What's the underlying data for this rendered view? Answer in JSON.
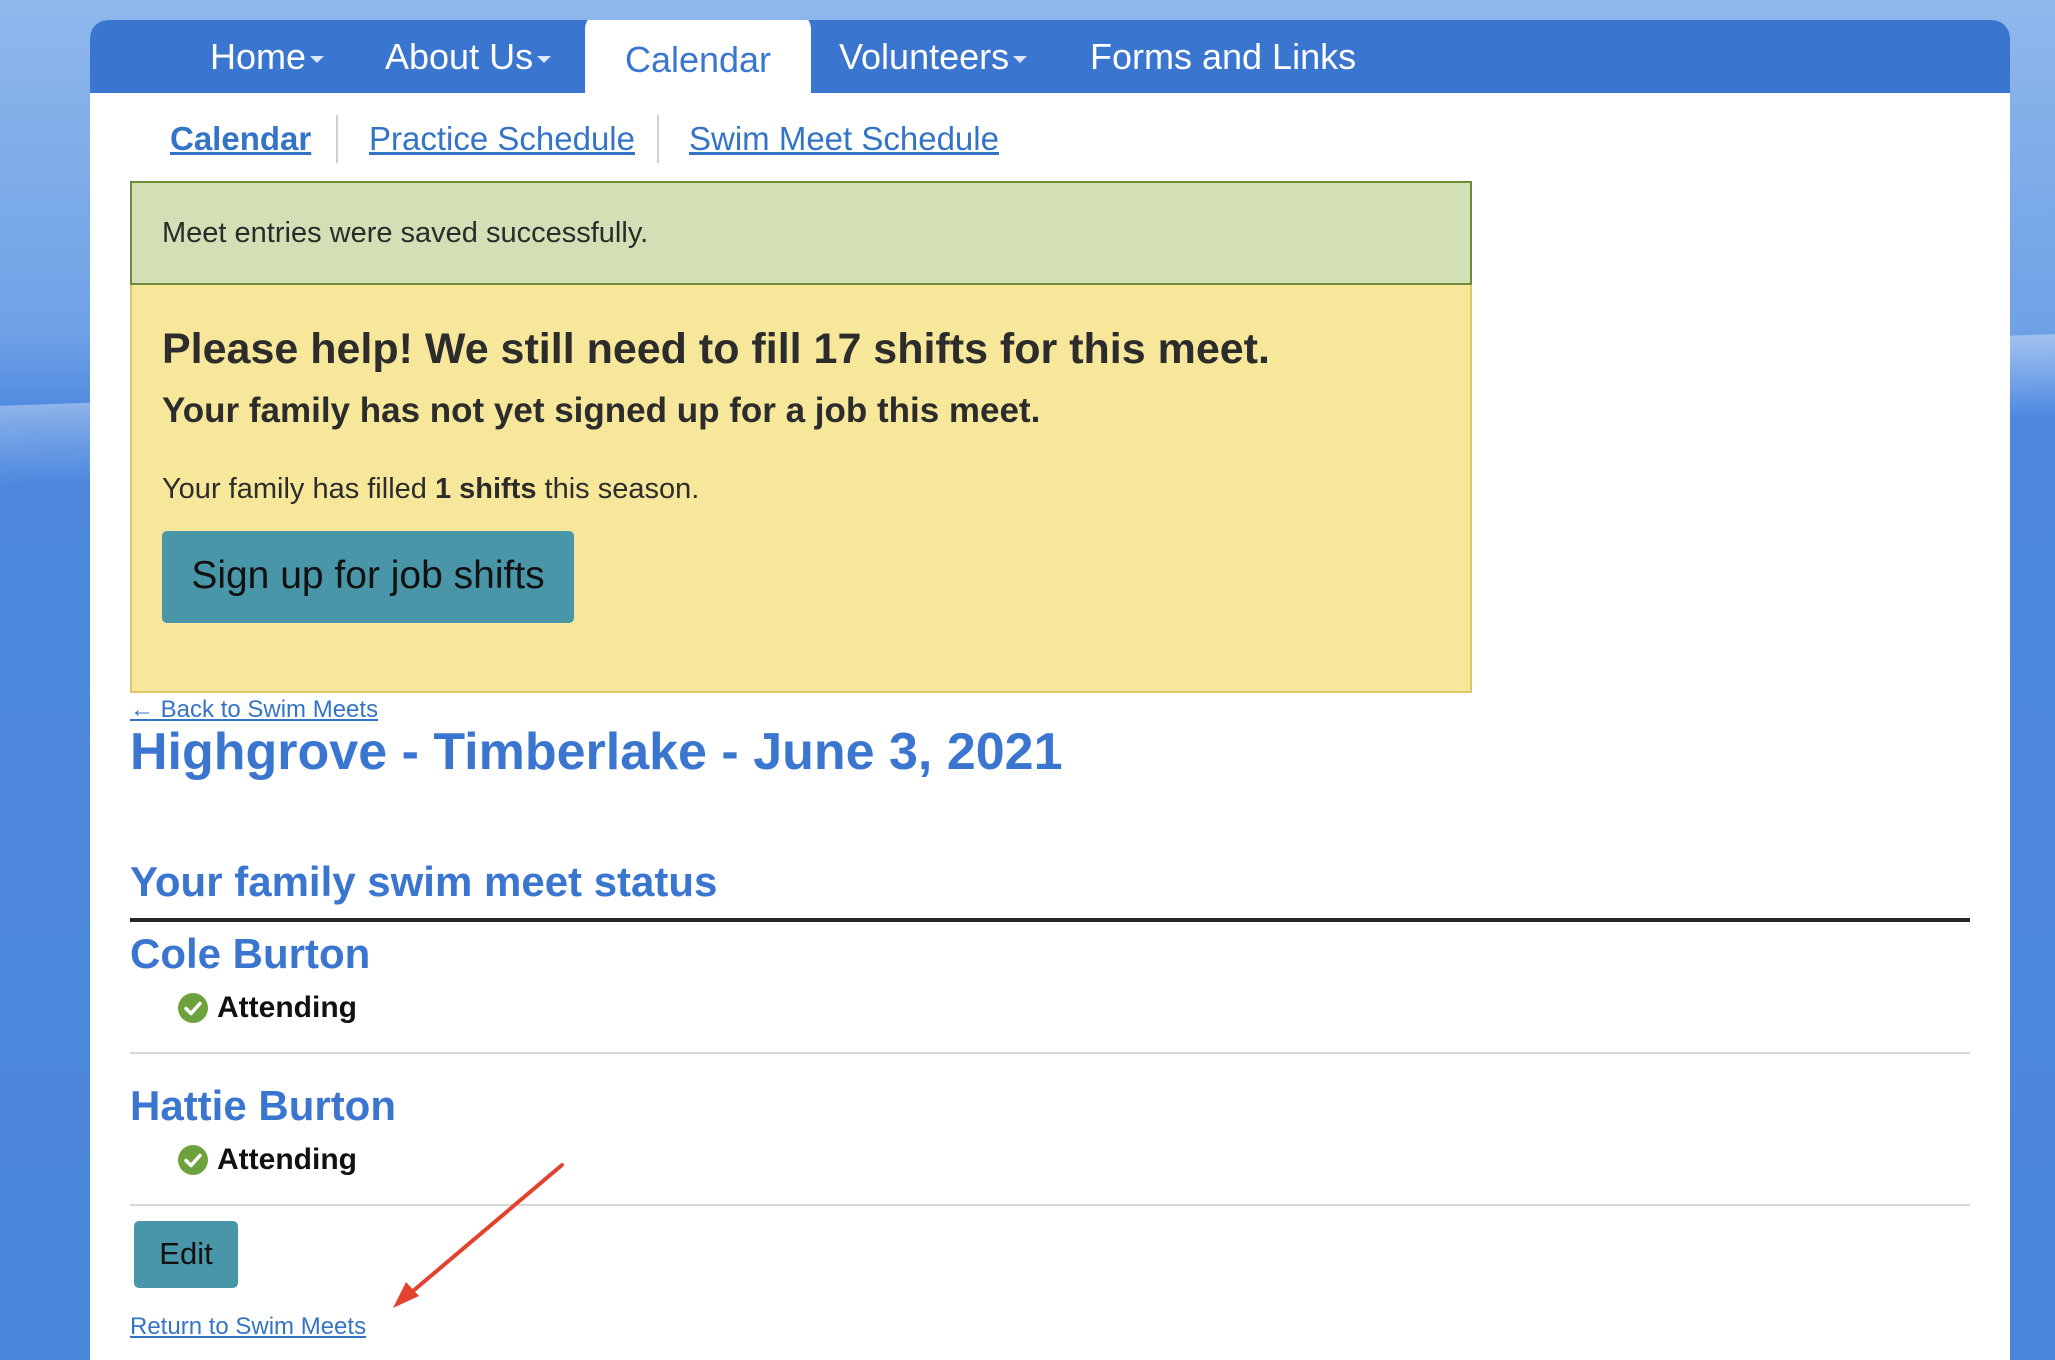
{
  "nav": {
    "items": [
      {
        "label": "Home",
        "dropdown": true
      },
      {
        "label": "About Us",
        "dropdown": true
      },
      {
        "label": "Calendar",
        "dropdown": false,
        "active": true
      },
      {
        "label": "Volunteers",
        "dropdown": true
      },
      {
        "label": "Forms and Links",
        "dropdown": false
      }
    ]
  },
  "subnav": {
    "items": [
      {
        "label": "Calendar",
        "active": true
      },
      {
        "label": "Practice Schedule",
        "active": false
      },
      {
        "label": "Swim Meet Schedule",
        "active": false
      }
    ]
  },
  "alerts": {
    "success": "Meet entries were saved successfully.",
    "warning": {
      "title": "Please help! We still need to fill 17 shifts for this meet.",
      "subtitle": "Your family has not yet signed up for a job this meet.",
      "filled_prefix": "Your family has filled ",
      "filled_count": "1 shifts",
      "filled_suffix": " this season.",
      "button_label": "Sign up for job shifts"
    }
  },
  "meet": {
    "back_link": "← Back to Swim Meets",
    "title": "Highgrove - Timberlake - June 3, 2021",
    "status_heading": "Your family swim meet status",
    "swimmers": [
      {
        "name": "Cole Burton",
        "status": "Attending"
      },
      {
        "name": "Hattie Burton",
        "status": "Attending"
      }
    ],
    "edit_label": "Edit",
    "return_link": "Return to Swim Meets"
  },
  "colors": {
    "nav_blue": "#3a75cf",
    "button_teal": "#4896a7",
    "success_bg": "#d3dfb5",
    "warning_bg": "#f6e79a",
    "check_green": "#6ea23c",
    "annotation_arrow": "#e2432f"
  },
  "icons": {
    "status": "check-circle-icon",
    "dropdown": "caret-down-icon",
    "annotation": "red-arrow-icon"
  }
}
